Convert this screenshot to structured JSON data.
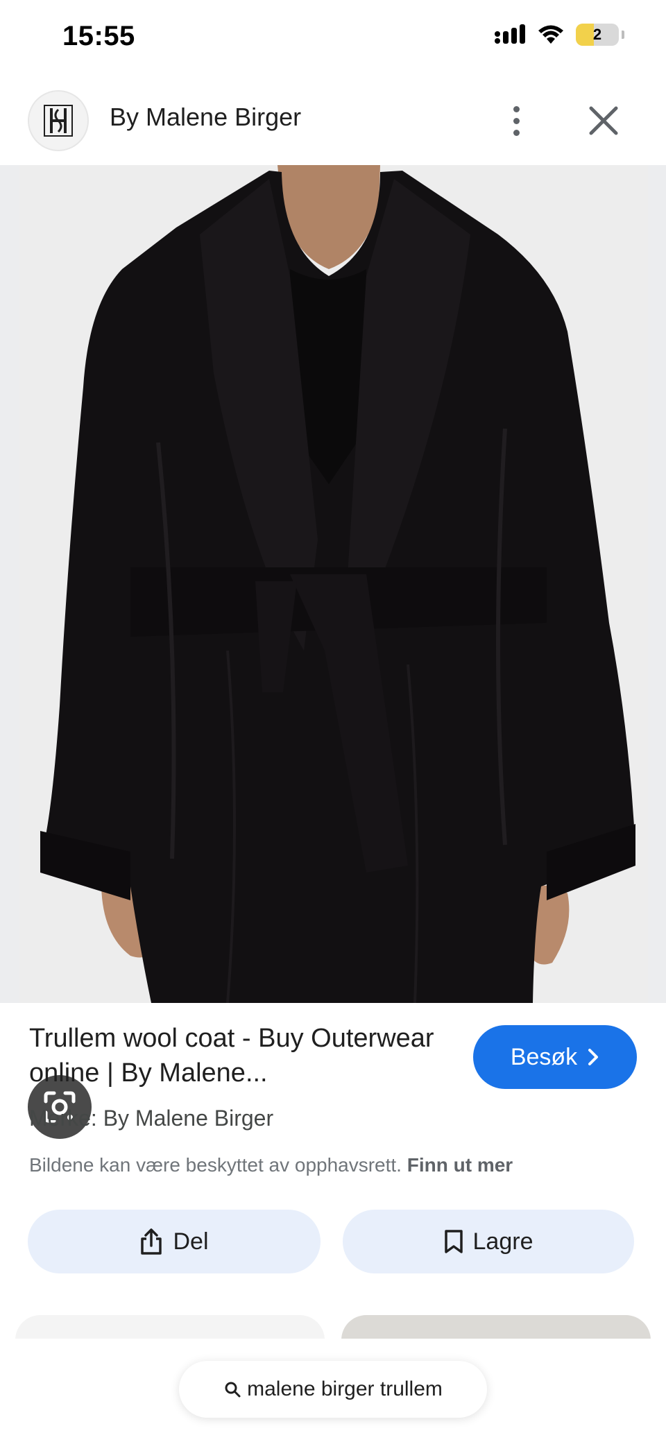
{
  "status_bar": {
    "time": "15:55",
    "battery_level": "2",
    "icons": [
      "signal-icon",
      "wifi-icon",
      "battery-icon"
    ]
  },
  "header": {
    "brand_name": "By Malene Birger",
    "icons": [
      "brand-logo",
      "more-vert-icon",
      "close-icon"
    ]
  },
  "product": {
    "title": "Trullem wool coat - Buy Outerwear online | By Malene...",
    "visit_label": "Besøk",
    "brand_line": "Merke: By Malene Birger",
    "copyright_text": "Bildene kan være beskyttet av opphavsrett.",
    "learn_more": "Finn ut mer"
  },
  "actions": {
    "share_label": "Del",
    "save_label": "Lagre"
  },
  "search": {
    "query": "malene birger trullem"
  },
  "colors": {
    "accent": "#1a73e8",
    "action_bg": "#e8effb",
    "coat": "#121012"
  }
}
